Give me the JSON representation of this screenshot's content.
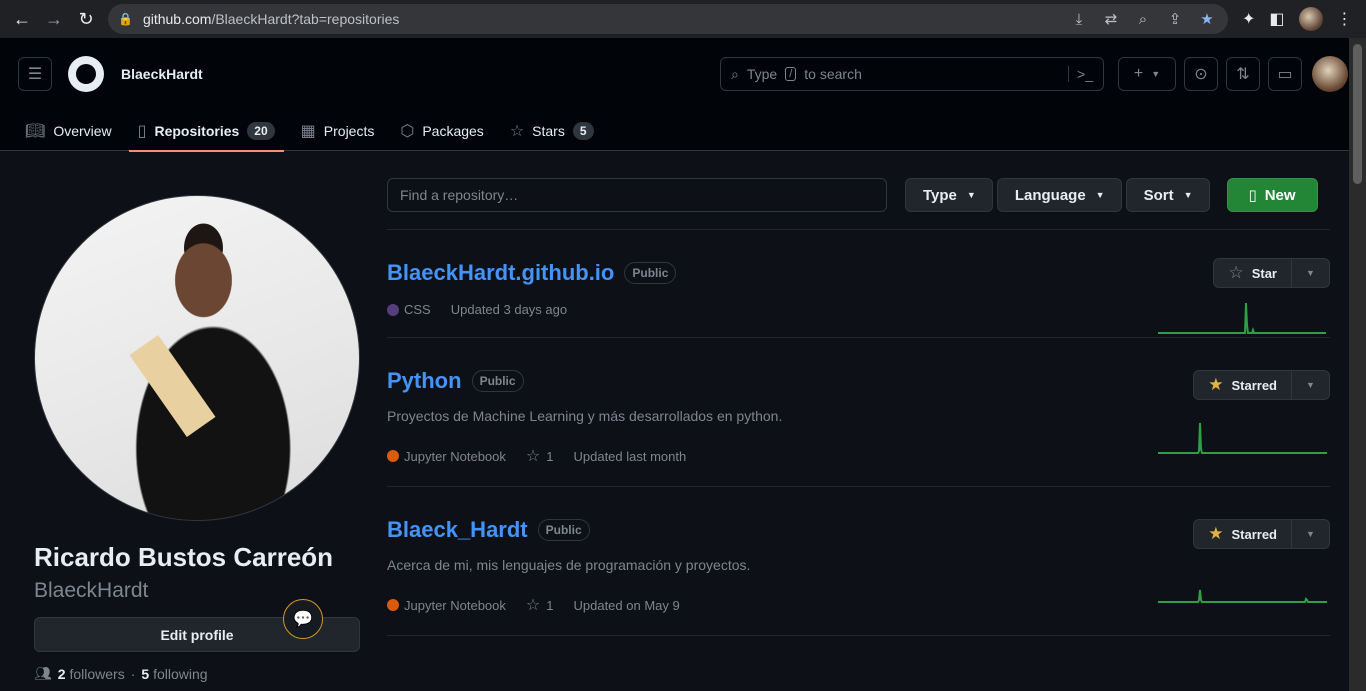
{
  "browser": {
    "url_host": "github.com",
    "url_path": "/BlaeckHardt?tab=repositories"
  },
  "header": {
    "username": "BlaeckHardt",
    "search_pre": "Type",
    "search_key": "/",
    "search_post": "to search"
  },
  "tabs": [
    {
      "label": "Overview"
    },
    {
      "label": "Repositories",
      "count": "20"
    },
    {
      "label": "Projects"
    },
    {
      "label": "Packages"
    },
    {
      "label": "Stars",
      "count": "5"
    }
  ],
  "profile": {
    "full_name": "Ricardo Bustos Carreón",
    "login": "BlaeckHardt",
    "edit_label": "Edit profile",
    "followers_count": "2",
    "followers_label": "followers",
    "following_count": "5",
    "following_label": "following"
  },
  "filters": {
    "find_placeholder": "Find a repository…",
    "type_label": "Type",
    "language_label": "Language",
    "sort_label": "Sort",
    "new_label": "New"
  },
  "repos": [
    {
      "name": "BlaeckHardt.github.io",
      "visibility": "Public",
      "description": "",
      "language": "CSS",
      "language_color": "#563d7c",
      "stars": "",
      "updated": "Updated 3 days ago",
      "star_label": "Star",
      "starred": false,
      "activity": [
        0,
        0,
        0,
        0,
        0,
        0,
        0,
        0,
        0,
        0,
        0,
        0,
        0,
        0,
        0,
        0,
        0,
        0,
        0,
        0,
        0,
        0,
        0,
        0,
        0,
        0,
        0,
        0,
        0,
        0,
        0,
        0,
        0,
        0,
        0,
        0,
        0,
        0,
        0,
        0,
        0,
        0,
        0,
        0,
        0,
        0,
        0,
        0,
        0,
        0,
        0,
        0,
        0,
        0,
        0,
        0,
        0,
        0,
        0,
        0,
        0,
        0,
        0,
        0,
        0,
        0,
        0,
        0,
        0,
        0,
        0,
        0,
        0,
        0,
        0,
        0,
        0,
        0,
        0,
        0,
        0,
        0,
        0,
        0,
        0,
        0,
        0,
        0,
        30,
        8,
        0,
        0,
        0,
        0,
        0,
        3,
        0,
        0,
        0,
        0,
        0,
        0,
        0,
        0,
        0,
        0,
        0,
        0,
        0,
        0,
        0,
        0,
        0,
        0,
        0,
        0,
        0,
        0,
        0,
        0,
        0,
        0,
        0,
        0,
        0,
        0,
        0,
        0,
        0,
        0,
        0,
        0,
        0,
        0,
        0,
        0,
        0,
        0,
        0,
        0,
        0,
        0,
        0,
        0,
        0,
        0,
        0,
        0,
        0,
        0,
        0,
        0,
        0,
        0,
        0,
        0,
        0,
        0,
        0,
        0,
        0,
        0,
        0,
        0,
        0,
        0,
        0,
        0,
        0
      ]
    },
    {
      "name": "Python",
      "visibility": "Public",
      "description": "Proyectos de Machine Learning y más desarrollados en python.",
      "language": "Jupyter Notebook",
      "language_color": "#da5b0b",
      "stars": "1",
      "updated": "Updated last month",
      "star_label": "Starred",
      "starred": true,
      "activity": [
        0,
        0,
        0,
        0,
        0,
        0,
        0,
        0,
        0,
        0,
        0,
        0,
        0,
        0,
        0,
        0,
        0,
        0,
        0,
        0,
        0,
        0,
        0,
        0,
        0,
        0,
        0,
        0,
        0,
        0,
        0,
        0,
        0,
        0,
        0,
        0,
        0,
        0,
        0,
        0,
        0,
        2,
        30,
        4,
        0,
        0,
        0,
        0,
        0,
        0,
        0,
        0,
        0,
        0,
        0,
        0,
        0,
        0,
        0,
        0,
        0,
        0,
        0,
        0,
        0,
        0,
        0,
        0,
        0,
        0,
        0,
        0,
        0,
        0,
        0,
        0,
        0,
        0,
        0,
        0,
        0,
        0,
        0,
        0,
        0,
        0,
        0,
        0,
        0,
        0,
        0,
        0,
        0,
        0,
        0,
        0,
        0,
        0,
        0,
        0,
        0,
        0,
        0,
        0,
        0,
        0,
        0,
        0,
        0,
        0,
        0,
        0,
        0,
        0,
        0,
        0,
        0,
        0,
        0,
        0,
        0,
        0,
        0,
        0,
        0,
        0,
        0,
        0,
        0,
        0,
        0,
        0,
        0,
        0,
        0,
        0,
        0,
        0,
        0,
        0,
        0,
        0,
        0,
        0,
        0,
        0,
        0,
        0,
        0,
        0,
        0,
        0,
        0,
        0,
        0,
        0,
        0,
        0,
        0,
        0,
        0,
        0,
        0,
        0,
        0,
        0,
        0,
        0,
        0,
        0
      ]
    },
    {
      "name": "Blaeck_Hardt",
      "visibility": "Public",
      "description": "Acerca de mi, mis lenguajes de programación y proyectos.",
      "language": "Jupyter Notebook",
      "language_color": "#da5b0b",
      "stars": "1",
      "updated": "Updated on May 9",
      "star_label": "Starred",
      "starred": true,
      "activity": [
        0,
        0,
        0,
        0,
        0,
        0,
        0,
        0,
        0,
        0,
        0,
        0,
        0,
        0,
        0,
        0,
        0,
        0,
        0,
        0,
        0,
        0,
        0,
        0,
        0,
        0,
        0,
        0,
        0,
        0,
        0,
        0,
        0,
        0,
        0,
        0,
        0,
        0,
        0,
        0,
        0,
        2,
        12,
        2,
        0,
        0,
        0,
        0,
        0,
        0,
        0,
        0,
        0,
        0,
        0,
        0,
        0,
        0,
        0,
        0,
        0,
        0,
        0,
        0,
        0,
        0,
        0,
        0,
        0,
        0,
        0,
        0,
        0,
        0,
        0,
        0,
        0,
        0,
        0,
        0,
        0,
        0,
        0,
        0,
        0,
        0,
        0,
        0,
        0,
        0,
        0,
        0,
        0,
        0,
        0,
        0,
        0,
        0,
        0,
        0,
        0,
        0,
        0,
        0,
        0,
        0,
        0,
        0,
        0,
        0,
        0,
        0,
        0,
        0,
        0,
        0,
        0,
        0,
        0,
        0,
        0,
        0,
        0,
        0,
        0,
        0,
        0,
        0,
        0,
        0,
        0,
        0,
        0,
        0,
        0,
        0,
        0,
        0,
        0,
        0,
        0,
        0,
        0,
        0,
        0,
        0,
        0,
        0,
        3,
        2,
        0,
        0,
        0,
        0,
        0,
        0,
        0,
        0,
        0,
        0,
        0,
        0,
        0,
        0,
        0,
        0,
        0,
        0,
        0,
        0
      ]
    }
  ]
}
